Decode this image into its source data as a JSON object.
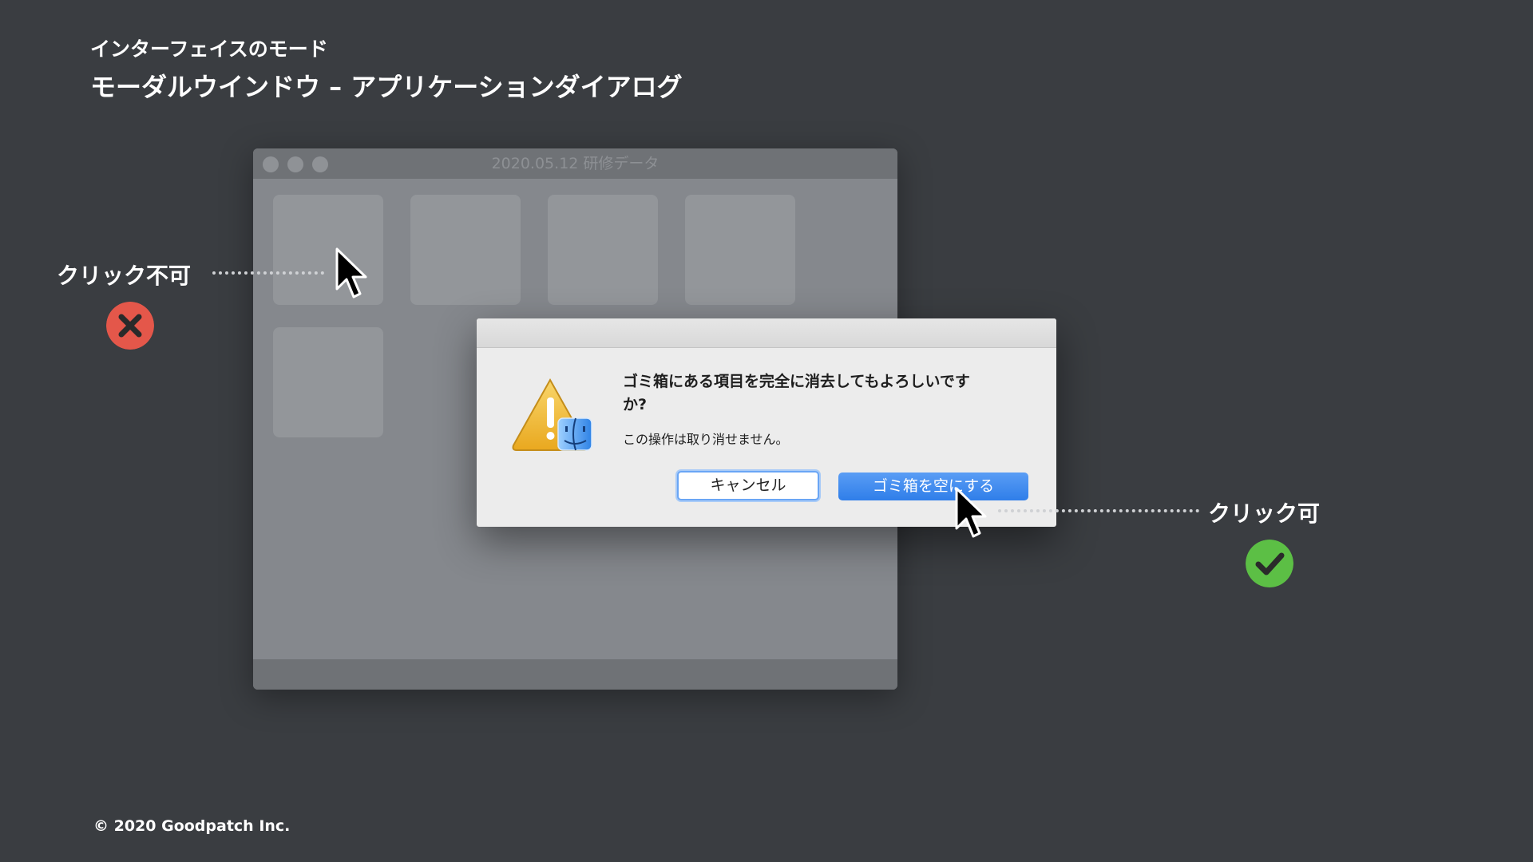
{
  "header": {
    "subtitle": "インターフェイスのモード",
    "title": "モーダルウインドウ – アプリケーションダイアログ"
  },
  "background_window": {
    "title": "2020.05.12 研修データ"
  },
  "dialog": {
    "message": "ゴミ箱にある項目を完全に消去してもよろしいですか?",
    "informative_text": "この操作は取り消せません。",
    "cancel_label": "キャンセル",
    "confirm_label": "ゴミ箱を空にする"
  },
  "annotations": {
    "not_clickable_label": "クリック不可",
    "clickable_label": "クリック可",
    "not_clickable_color": "#e4574a",
    "clickable_color": "#5cbf45"
  },
  "footer": {
    "copyright": "© 2020 Goodpatch Inc."
  }
}
